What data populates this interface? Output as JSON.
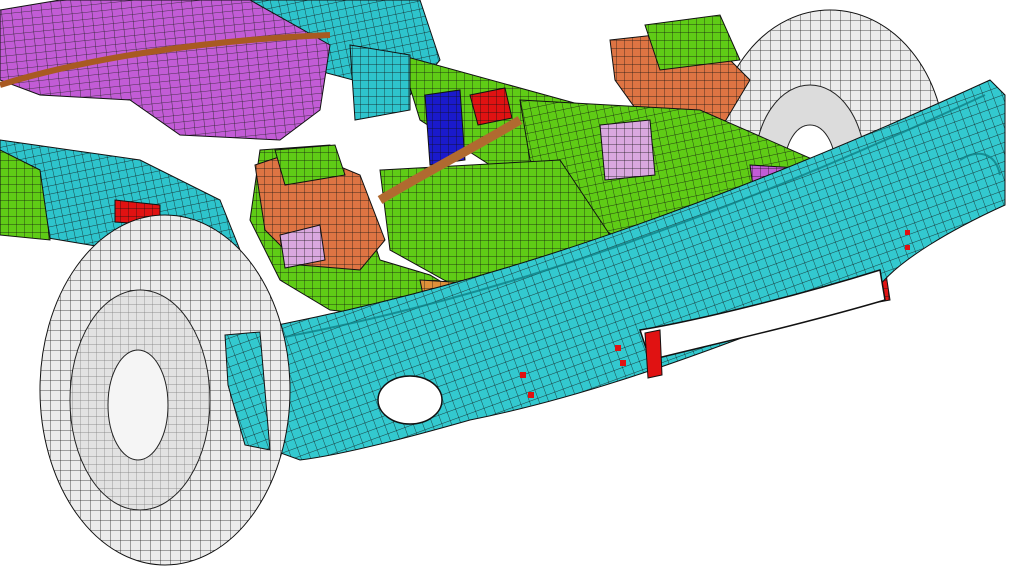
{
  "viewport": {
    "background": "#ffffff",
    "render_style": "finite-element mesh, shaded parts with black element edges"
  },
  "palette": {
    "bumper": "#33c9cf",
    "frame_rail": "#2ec4cc",
    "crossmember": "#5fcc16",
    "fuel_tank": "#c25cd6",
    "shock_tower": "#de7443",
    "bracket_red": "#e01212",
    "bracket_blue": "#1a1acc",
    "bracket_orange": "#e0903a",
    "mount_pink": "#d9a8df",
    "tire": "#ececec",
    "mesh_line": "#111111"
  },
  "parts": [
    {
      "id": "fuel-tank",
      "color_key": "fuel_tank"
    },
    {
      "id": "left-frame-rail",
      "color_key": "frame_rail"
    },
    {
      "id": "rear-frame-rail",
      "color_key": "frame_rail"
    },
    {
      "id": "rear-crossmember",
      "color_key": "crossmember"
    },
    {
      "id": "front-crossmember",
      "color_key": "crossmember"
    },
    {
      "id": "left-shock-tower",
      "color_key": "shock_tower"
    },
    {
      "id": "right-shock-tower",
      "color_key": "shock_tower"
    },
    {
      "id": "blue-bracket",
      "color_key": "bracket_blue"
    },
    {
      "id": "red-bracket",
      "color_key": "bracket_red"
    },
    {
      "id": "lower-control-arm",
      "color_key": "bracket_orange"
    },
    {
      "id": "pink-mount",
      "color_key": "mount_pink"
    },
    {
      "id": "front-bumper",
      "color_key": "bumper"
    },
    {
      "id": "left-front-tire",
      "color_key": "tire"
    },
    {
      "id": "right-front-tire",
      "color_key": "tire"
    }
  ]
}
